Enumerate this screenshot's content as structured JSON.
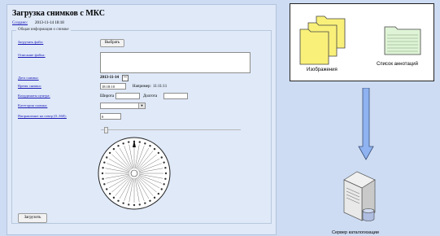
{
  "form": {
    "title": "Загрузка снимков с МКС",
    "created_label": "Создано:",
    "created_value": "2013-11-14 18:18",
    "legend": "Общая информация о снимке",
    "file_label": "Загрузить файл:",
    "browse_label": "Выбрать",
    "description_label": "Описание файла:",
    "description_value": "",
    "date_label": "Дата снимка:",
    "date_value": "2013-11-14",
    "time_label": "Время снимка:",
    "time_value": "18:18:10",
    "time_example_label": "Например:",
    "time_example_value": "11:11:11",
    "coords_label": "Координаты центра:",
    "lat_label": "Широта",
    "lat_value": "",
    "lon_label": "Долгота",
    "lon_value": "",
    "type_label": "Категория снимка:",
    "type_value": "",
    "direction_label": "Направление на север (0..360):",
    "direction_value": "0",
    "submit_label": "Загрузить"
  },
  "diagram": {
    "images_label": "Изображения",
    "annotations_label": "Список аннотаций",
    "server_label": "Сервер каталогизации"
  },
  "colors": {
    "background": "#cddcf2",
    "panel": "#dfe9f8",
    "link": "#1b1bb5",
    "folder_yellow": "#f9f07a",
    "folder_green": "#dff3d6",
    "arrow": "#8fb3f0"
  },
  "compass": {
    "direction_degrees": 0,
    "tick_count": 36
  }
}
